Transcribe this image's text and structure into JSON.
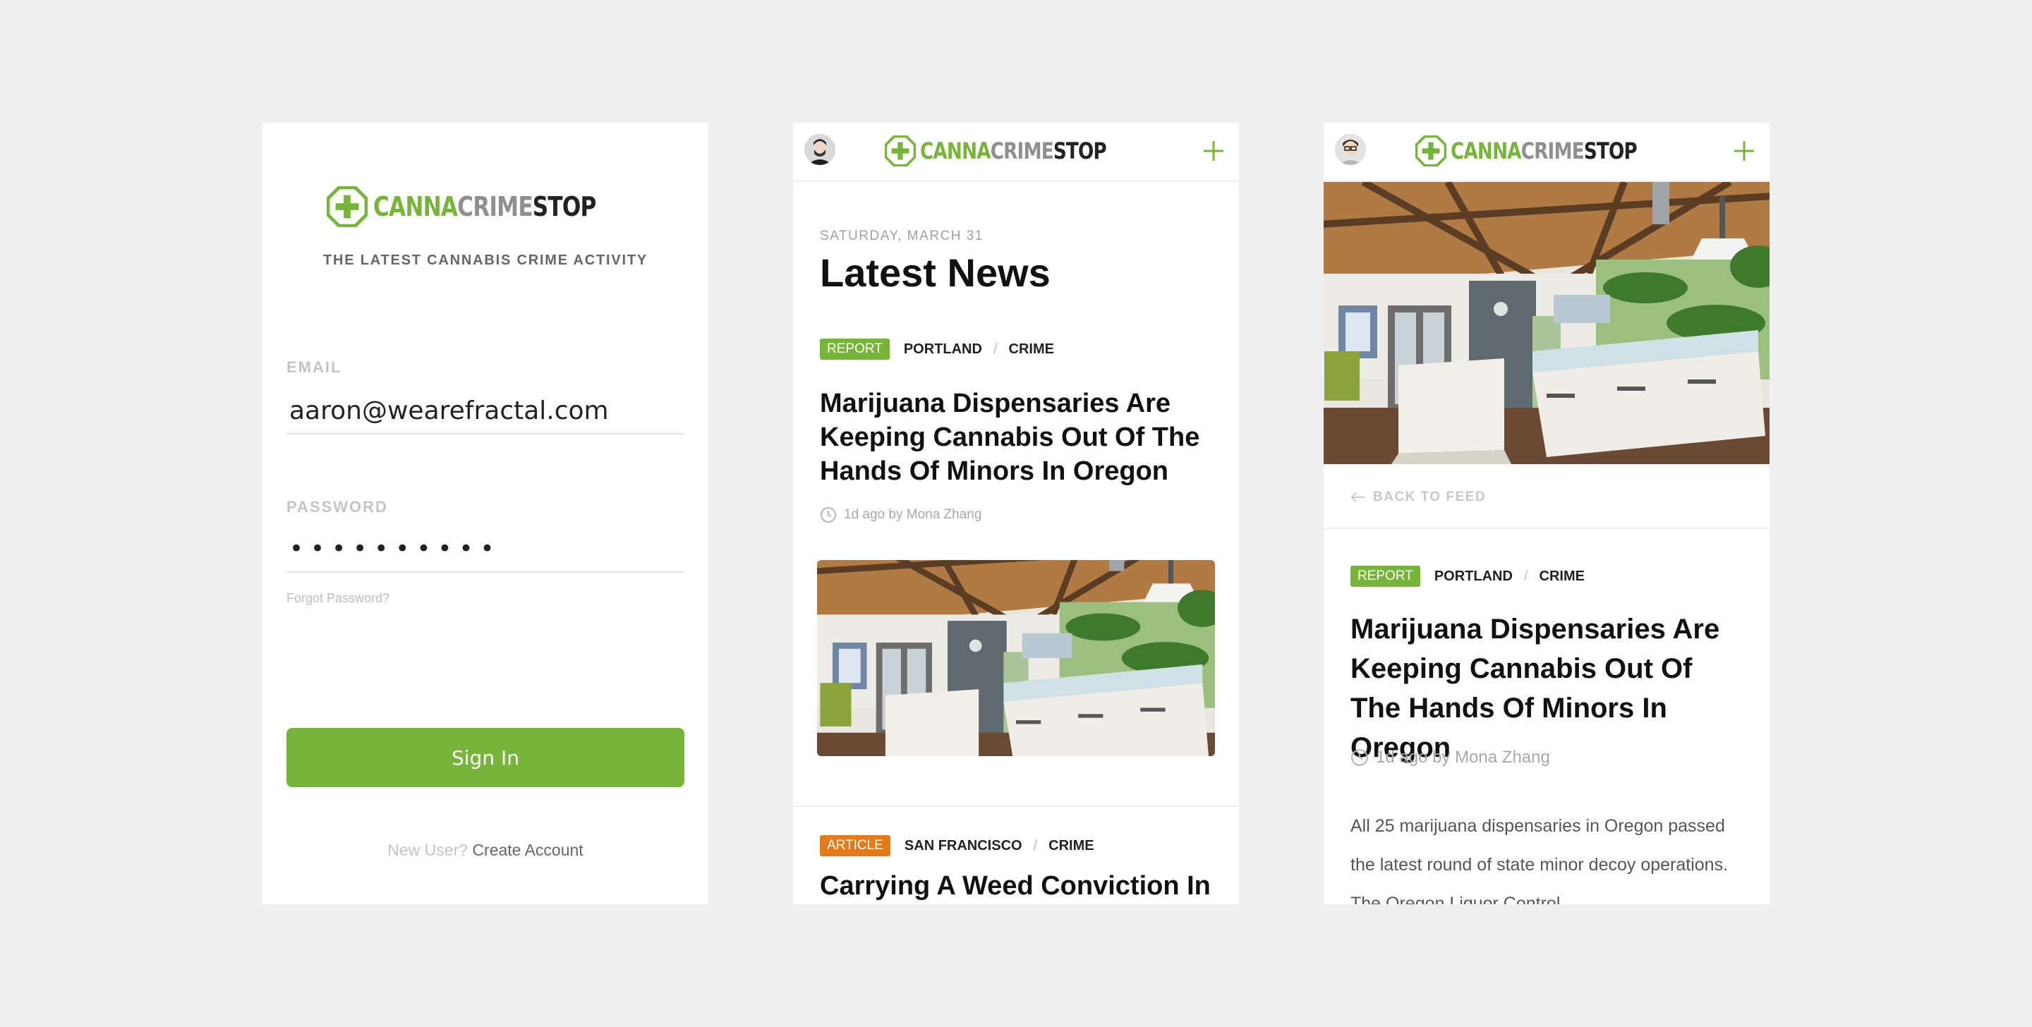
{
  "brand": {
    "part1": "CANNA",
    "part2": "CRIME",
    "part3": "STOP",
    "colors": {
      "green": "#76b43a",
      "gray": "#8f8f8f",
      "dark": "#222222",
      "orange": "#e37b1c"
    }
  },
  "login": {
    "tagline": "THE LATEST CANNABIS CRIME ACTIVITY",
    "email_label": "EMAIL",
    "email_value": "aaron@wearefractal.com",
    "password_label": "PASSWORD",
    "password_value": "••••••••••",
    "forgot_label": "Forgot Password?",
    "signin_label": "Sign In",
    "new_user_prompt": "New User?",
    "create_account_label": "Create Account"
  },
  "feed": {
    "date": "SATURDAY, MARCH 31",
    "title": "Latest News",
    "articles": [
      {
        "badge": "REPORT",
        "location": "PORTLAND",
        "category": "CRIME",
        "headline": "Marijuana Dispensaries Are Keeping Cannabis Out Of The Hands Of Minors In Oregon",
        "meta": "1d ago by Mona Zhang"
      },
      {
        "badge": "ARTICLE",
        "location": "SAN FRANCISCO",
        "category": "CRIME",
        "headline": "Carrying A Weed Conviction In"
      }
    ]
  },
  "detail": {
    "back_label": "BACK TO FEED",
    "badge": "REPORT",
    "location": "PORTLAND",
    "category": "CRIME",
    "headline": "Marijuana Dispensaries Are Keeping Cannabis Out Of The Hands Of Minors In Oregon",
    "meta": "1d ago by Mona Zhang",
    "body": "All 25 marijuana dispensaries in Oregon passed the latest round of state minor decoy operations. The Oregon Liquor Control"
  }
}
